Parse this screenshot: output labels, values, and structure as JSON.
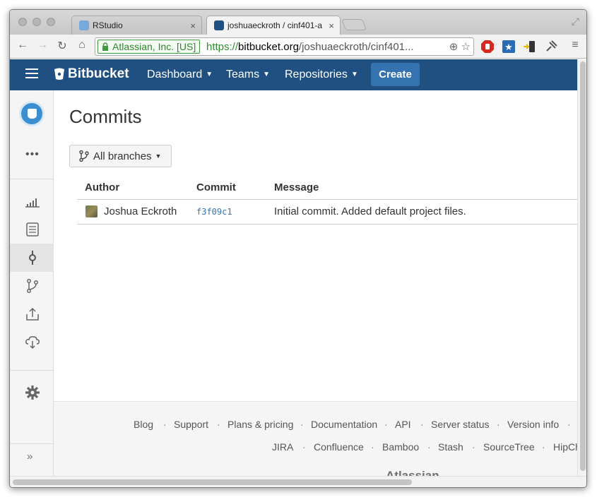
{
  "browser": {
    "tabs": [
      {
        "title": "RStudio",
        "close": "×"
      },
      {
        "title": "joshuaeckroth / cinf401-a",
        "close": "×"
      }
    ],
    "ev_badge": "Atlassian, Inc. [US]",
    "url_scheme": "https://",
    "url_host": "bitbucket.org",
    "url_path": "/joshuaeckroth/cinf401..."
  },
  "header": {
    "logo": "Bitbucket",
    "nav": [
      {
        "label": "Dashboard"
      },
      {
        "label": "Teams"
      },
      {
        "label": "Repositories"
      }
    ],
    "create_label": "Create",
    "accent": "#205081",
    "button_color": "#3572b0"
  },
  "sidebar": {
    "more": "•••",
    "expand": "»",
    "items": [
      {
        "icon": "chart-icon"
      },
      {
        "icon": "source-icon"
      },
      {
        "icon": "commit-icon",
        "active": true
      },
      {
        "icon": "branches-icon"
      },
      {
        "icon": "upload-icon"
      },
      {
        "icon": "cloud-download-icon"
      },
      {
        "icon": "gear-icon"
      }
    ]
  },
  "main": {
    "title": "Commits",
    "branch_filter": "All branches",
    "table": {
      "headers": [
        "Author",
        "Commit",
        "Message"
      ],
      "rows": [
        {
          "author": "Joshua Eckroth",
          "commit": "f3f09c1",
          "message": "Initial commit. Added default project files."
        }
      ]
    }
  },
  "footer": {
    "row1": [
      "Blog",
      "Support",
      "Plans & pricing",
      "Documentation",
      "API",
      "Server status",
      "Version info"
    ],
    "row2": [
      "JIRA",
      "Confluence",
      "Bamboo",
      "Stash",
      "SourceTree",
      "HipChat"
    ],
    "brand": "Atlassian"
  }
}
